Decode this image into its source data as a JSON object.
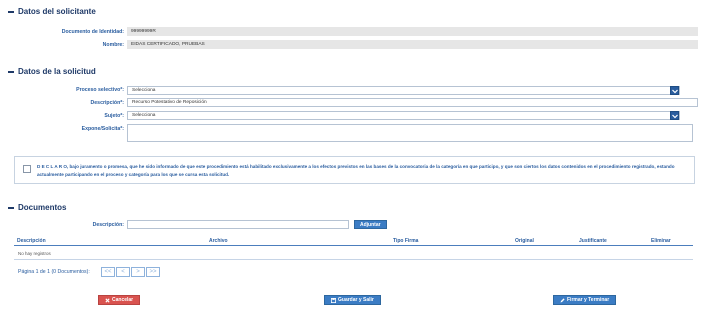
{
  "solicitante": {
    "title": "Datos del solicitante",
    "documento_label": "Documento de Identidad:",
    "documento_value": "99999999R",
    "nombre_label": "Nombre:",
    "nombre_value": "EIDAS CERTIFICADO, PRUEBAS"
  },
  "solicitud": {
    "title": "Datos de la solicitud",
    "proceso_label": "Proceso selectivo*:",
    "proceso_value": "Selecciona",
    "descripcion_label": "Descripción*:",
    "descripcion_value": "Recurso Potestativo de Reposición",
    "sujeto_label": "Sujeto*:",
    "sujeto_value": "Selecciona",
    "expone_label": "Expone/Solicita*:",
    "expone_value": ""
  },
  "declaro": {
    "text": "D E C L A R O, bajo juramento o promesa, que he sido informado de que este procedimiento está habilitado exclusivamente a los efectos previstos en las bases de la convocatoria de la categoría en que participo, y que son ciertos los datos contenidos en el procedimiento registrado, estando actualmente participando en el proceso y categoría para los que se cursa esta solicitud."
  },
  "documentos": {
    "title": "Documentos",
    "descripcion_label": "Descripción:",
    "descripcion_value": "",
    "adjuntar_label": "Adjuntar",
    "columns": [
      "Descripción",
      "Archivo",
      "Tipo Firma",
      "Original",
      "Justificante",
      "Eliminar"
    ],
    "empty_text": "No hay registros",
    "pager_text": "Página 1 de 1 (0 Documentos):",
    "pager_buttons": [
      "<<",
      "<",
      ">",
      ">>"
    ]
  },
  "actions": {
    "cancelar": "Cancelar",
    "guardar": "Guardar y Salir",
    "firmar": "Firmar y Terminar"
  },
  "colors": {
    "accent": "#2a5d9f",
    "title": "#1f3a68",
    "cancel": "#d9534f"
  }
}
